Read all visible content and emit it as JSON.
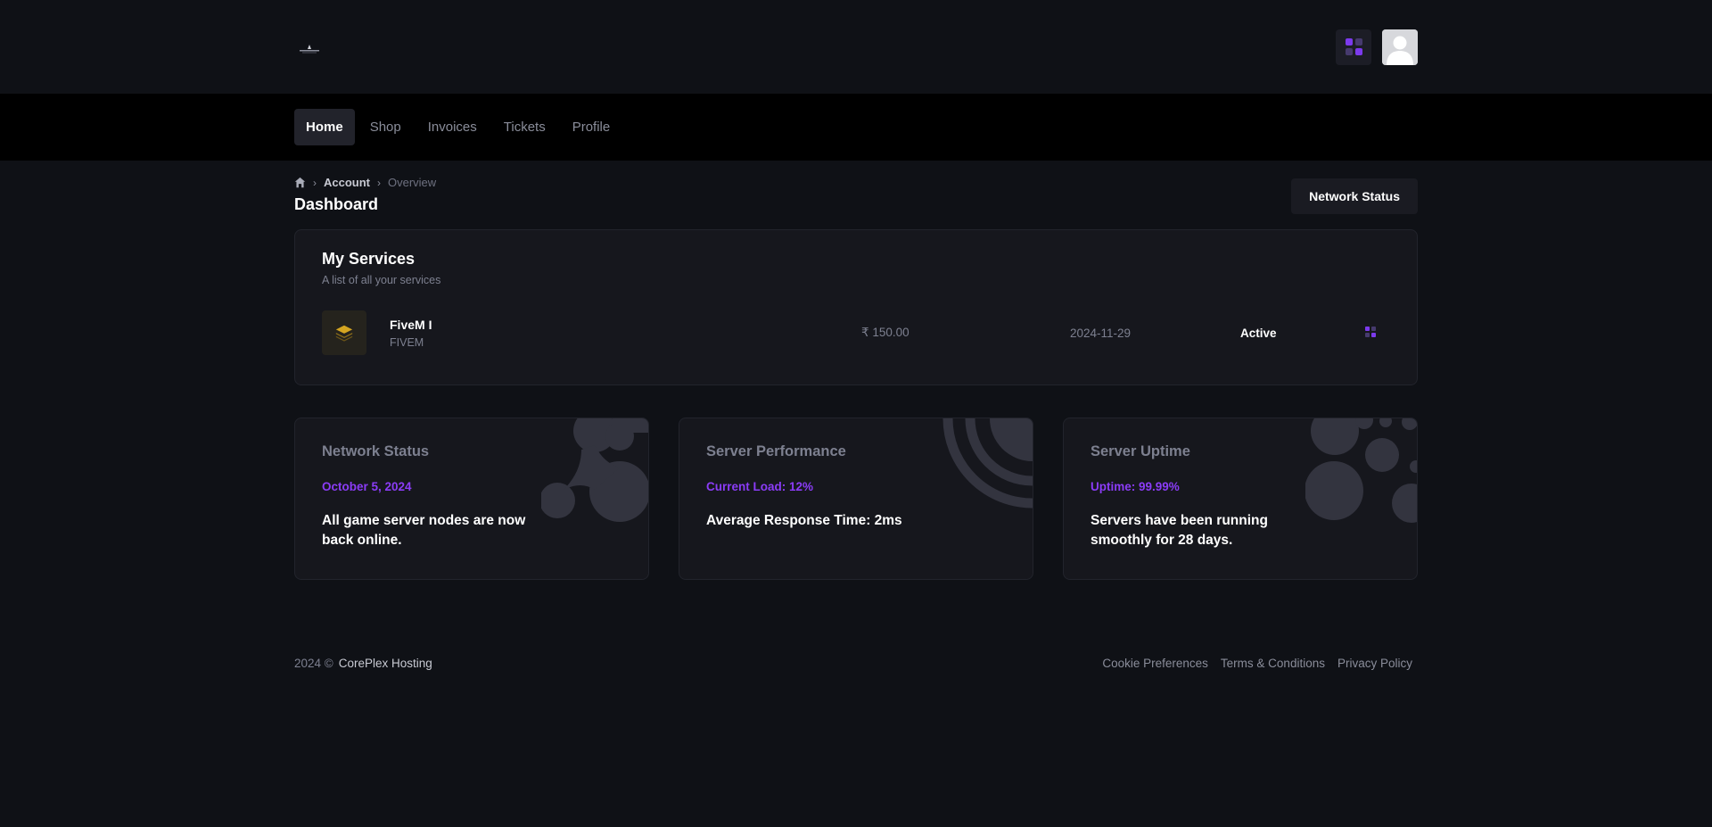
{
  "header": {
    "logo_icon": "logo-icon",
    "apps_icon": "apps-grid-icon",
    "avatar_icon": "user-avatar-icon"
  },
  "nav": {
    "items": [
      {
        "label": "Home",
        "active": true
      },
      {
        "label": "Shop",
        "active": false
      },
      {
        "label": "Invoices",
        "active": false
      },
      {
        "label": "Tickets",
        "active": false
      },
      {
        "label": "Profile",
        "active": false
      }
    ]
  },
  "breadcrumb": {
    "home_icon": "home-icon",
    "account": "Account",
    "current": "Overview"
  },
  "page": {
    "title": "Dashboard",
    "network_status_button": "Network Status"
  },
  "services": {
    "title": "My Services",
    "subtitle": "A list of all your services",
    "items": [
      {
        "name": "FiveM I",
        "type": "FIVEM",
        "price": "₹ 150.00",
        "date": "2024-11-29",
        "status": "Active",
        "icon": "layers-icon",
        "icon_color": "#d4a521"
      }
    ]
  },
  "info_cards": [
    {
      "title": "Network Status",
      "meta": "October 5, 2024",
      "text": "All game server nodes are now back online."
    },
    {
      "title": "Server Performance",
      "meta": "Current Load: 12%",
      "text": "Average Response Time: 2ms"
    },
    {
      "title": "Server Uptime",
      "meta": "Uptime: 99.99%",
      "text": "Servers have been running smoothly for 28 days."
    }
  ],
  "footer": {
    "year": "2024 ©",
    "brand": "CorePlex Hosting",
    "links": [
      "Cookie Preferences",
      "Terms & Conditions",
      "Privacy Policy"
    ]
  },
  "colors": {
    "background": "#0f1116",
    "accent": "#7c3aed",
    "card": "#16171d"
  }
}
